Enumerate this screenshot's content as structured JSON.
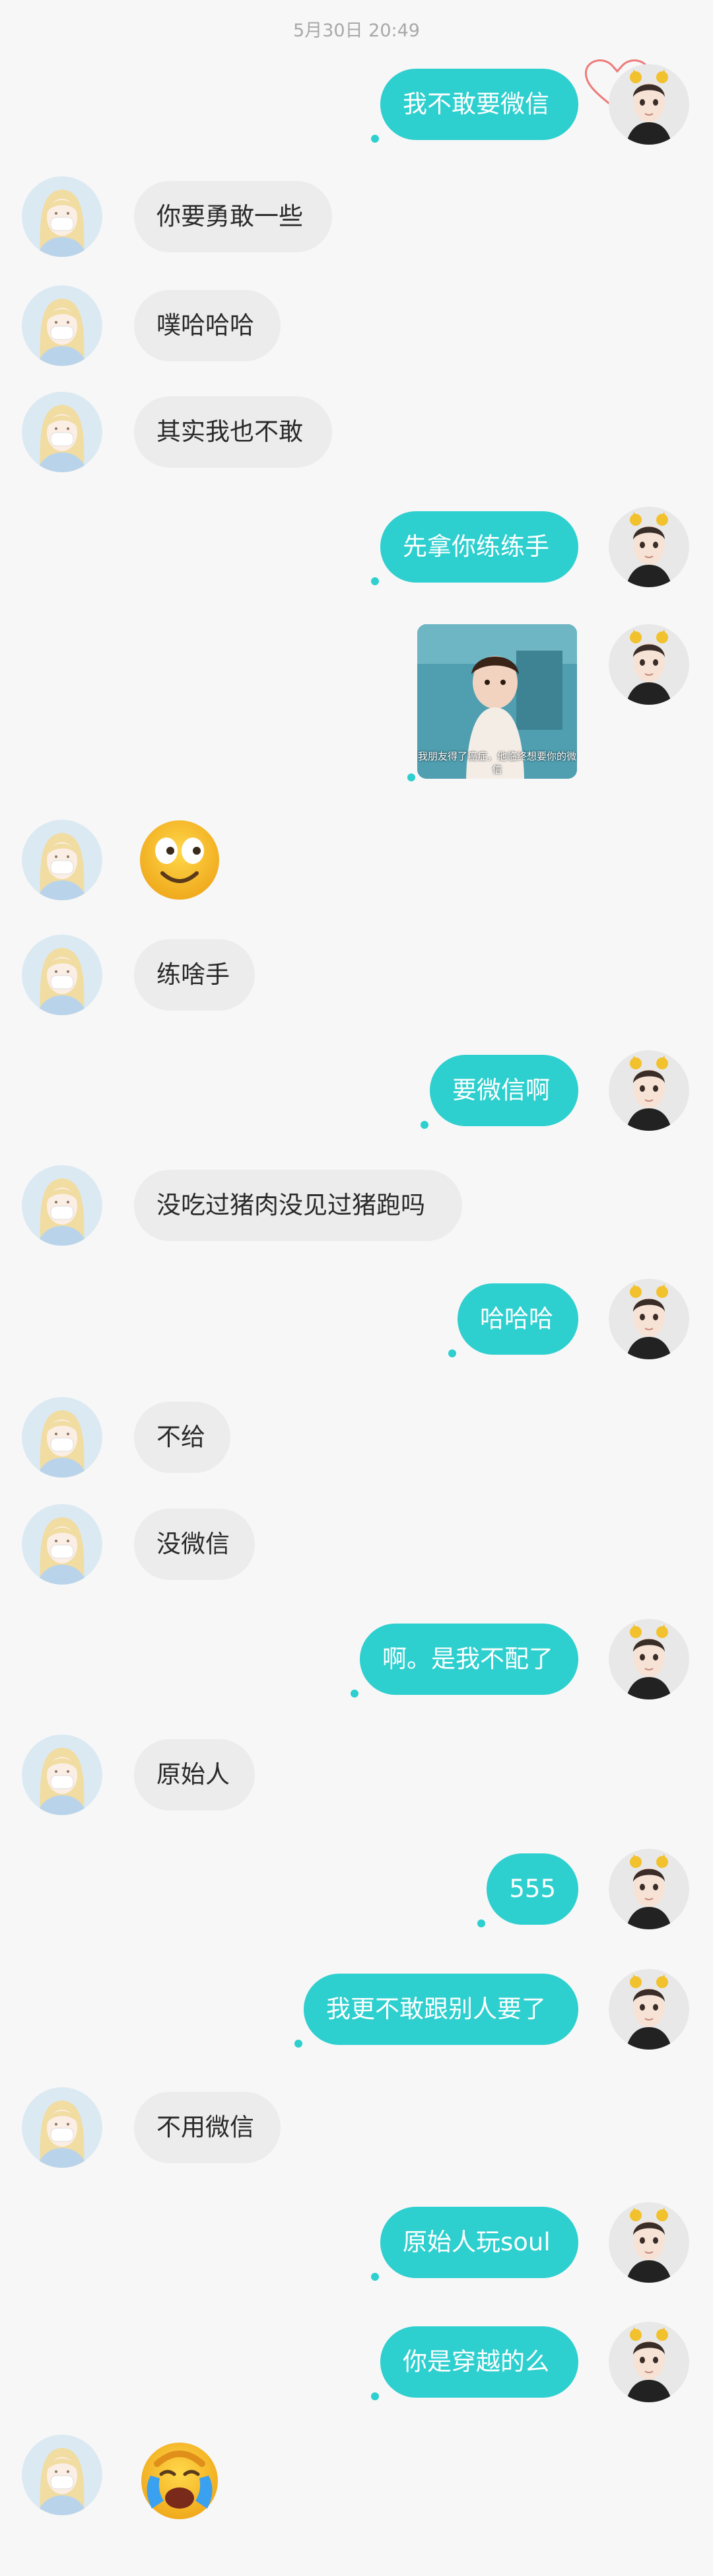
{
  "timestamp": "5月30日 20:49",
  "colors": {
    "accent": "#2ecfcf",
    "incoming_bubble": "#ececec",
    "background": "#f7f7f7"
  },
  "messages": [
    {
      "side": "right",
      "type": "text",
      "text": "我不敢要微信"
    },
    {
      "side": "left",
      "type": "text",
      "text": "你要勇敢一些"
    },
    {
      "side": "left",
      "type": "text",
      "text": "噗哈哈哈"
    },
    {
      "side": "left",
      "type": "text",
      "text": "其实我也不敢"
    },
    {
      "side": "right",
      "type": "text",
      "text": "先拿你练练手"
    },
    {
      "side": "right",
      "type": "image",
      "caption": "我朋友得了癌症，他临终想要你的微信"
    },
    {
      "side": "left",
      "type": "emoji",
      "icon": "smiling-emoji"
    },
    {
      "side": "left",
      "type": "text",
      "text": "练啥手"
    },
    {
      "side": "right",
      "type": "text",
      "text": "要微信啊"
    },
    {
      "side": "left",
      "type": "text",
      "text": "没吃过猪肉没见过猪跑吗"
    },
    {
      "side": "right",
      "type": "text",
      "text": "哈哈哈"
    },
    {
      "side": "left",
      "type": "text",
      "text": "不给"
    },
    {
      "side": "left",
      "type": "text",
      "text": "没微信"
    },
    {
      "side": "right",
      "type": "text",
      "text": "啊。是我不配了"
    },
    {
      "side": "left",
      "type": "text",
      "text": "原始人"
    },
    {
      "side": "right",
      "type": "text",
      "text": "555"
    },
    {
      "side": "right",
      "type": "text",
      "text": "我更不敢跟别人要了"
    },
    {
      "side": "left",
      "type": "text",
      "text": "不用微信"
    },
    {
      "side": "right",
      "type": "text",
      "text": "原始人玩soul"
    },
    {
      "side": "right",
      "type": "text",
      "text": "你是穿越的么"
    },
    {
      "side": "left",
      "type": "emoji",
      "icon": "crying-emoji"
    }
  ]
}
